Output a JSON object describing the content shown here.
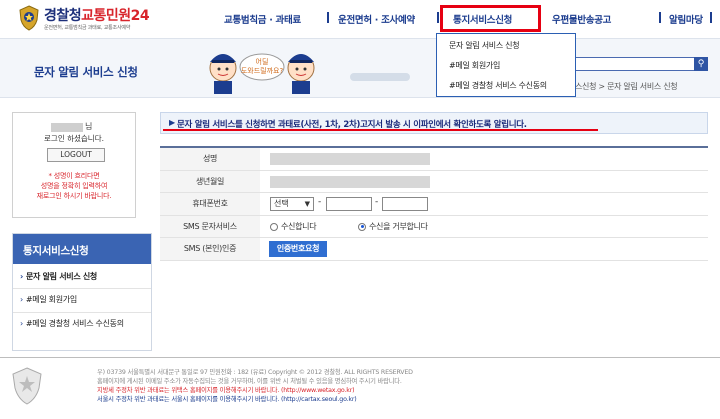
{
  "header": {
    "logo_main": "경찰청",
    "logo_accent": "교통민원24",
    "logo_sub": "운전면허, 교통범칙금 과태료, 교통조사예약",
    "nav": [
      "교통범칙금 · 과태료",
      "운전면허 · 조사예약",
      "통지서비스신청",
      "우편물반송공고",
      "알림마당"
    ]
  },
  "dropdown": {
    "items": [
      "문자 알림 서비스 신청",
      "#메일 회원가입",
      "#메일 경찰청 서비스 수신동의"
    ]
  },
  "banner": {
    "page_title": "문자 알림 서비스 신청",
    "bubble": "어딜 도와드릴까요?",
    "search_icon": "search-icon",
    "breadcrumb": "스신청 > 문자 알림 서비스 신청"
  },
  "login": {
    "suffix": "님",
    "message": "로그인 하셨습니다.",
    "logout": "LOGOUT",
    "notes": [
      "* 성명이 흐리다면",
      "성명을 정확히 입력하여",
      "재로그인 하시기 바랍니다."
    ]
  },
  "side_menu": {
    "title": "통지서비스신청",
    "items": [
      "문자 알림 서비스 신청",
      "#메일 회원가입",
      "#메일 경찰청 서비스 수신동의"
    ]
  },
  "notice": "문자 알림 서비스를 신청하면 과태료(사전, 1차, 2차)고지서 발송 시 이파인에서 확인하도록 알립니다.",
  "form": {
    "labels": [
      "성명",
      "생년월일",
      "휴대폰번호",
      "SMS 문자서비스",
      "SMS (본인)인증"
    ],
    "phone_select": "선택",
    "sms_options": [
      "수신합니다",
      "수신을 거부합니다"
    ],
    "sms_selected_index": 1,
    "auth_button": "인증번호요청"
  },
  "footer": {
    "lines": [
      "우) 03739 서울특별시 서대문구 통일로 97  민원전화 : 182 (유료)       Copyright © 2012 경찰청. ALL RIGHTS RESERVED",
      "홈페이지에 게시된 이메일 주소가 자동수집되는 것을 거부하며, 이를 위반 시 처벌될 수 있음을 명심하여 주시기 바랍니다.",
      "지방세 주정차 위반 과태료는 위택스 홈페이지를 이용해주시기 바랍니다. (http://www.wetax.go.kr)",
      "서울시 주정차 위반 과태료는 서울시 홈페이지를 이용해주시기 바랍니다. (http://cartax.seoul.go.kr)"
    ]
  },
  "colors": {
    "brand_blue": "#1c3d8f",
    "accent_red": "#e60012",
    "side_head": "#3a64b3",
    "button_blue": "#2f6ed1"
  }
}
